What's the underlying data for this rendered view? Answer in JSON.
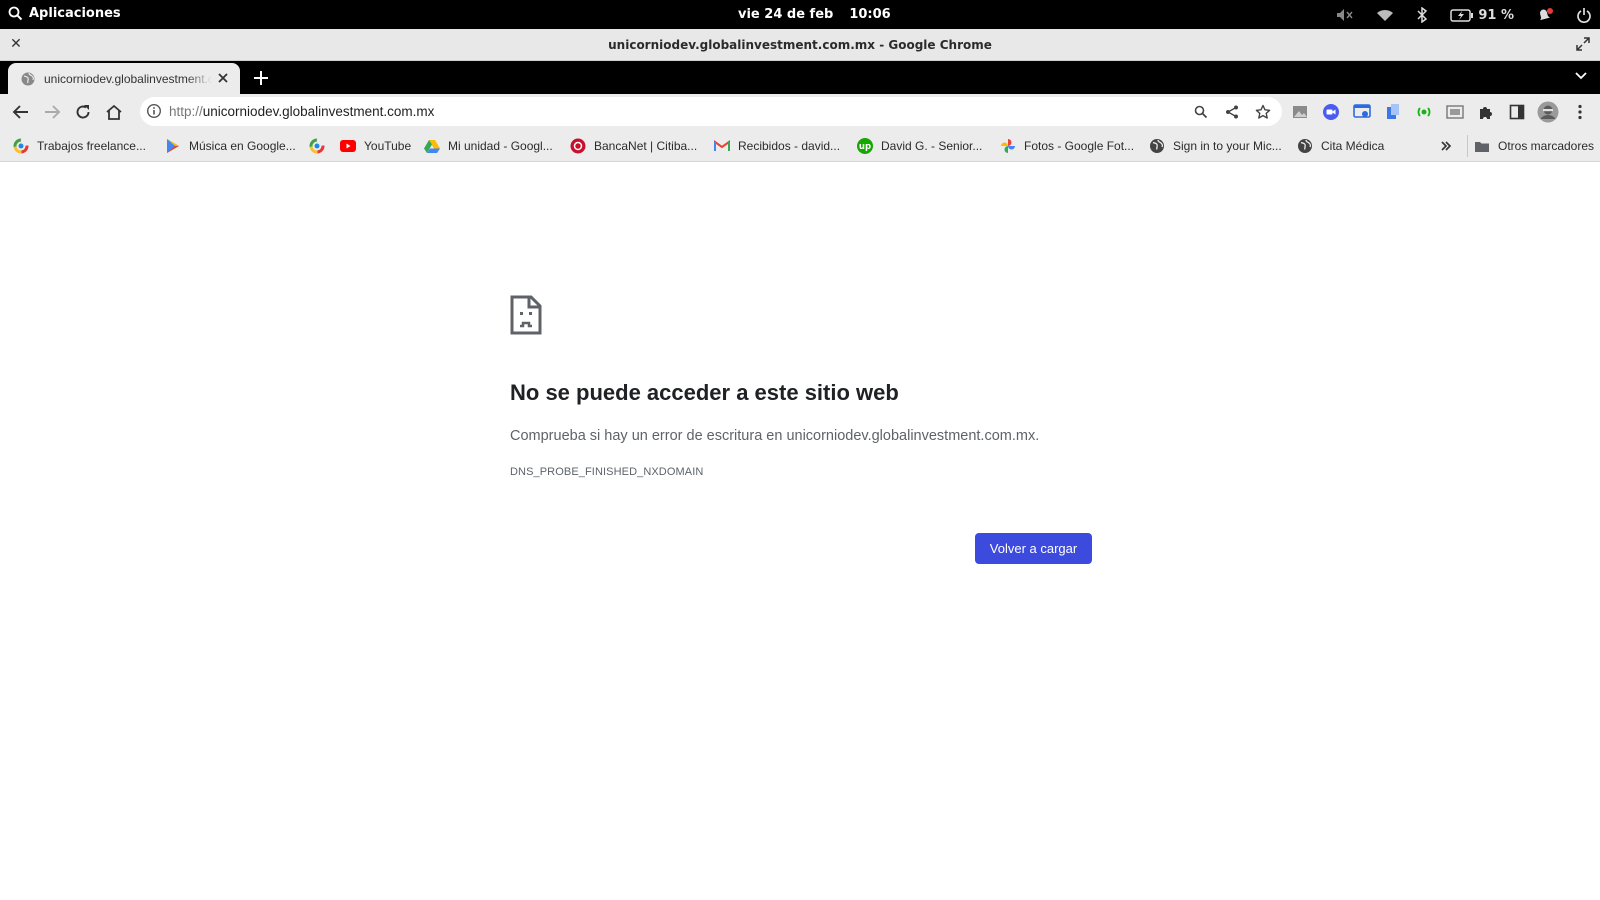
{
  "system_bar": {
    "apps_label": "Aplicaciones",
    "date": "vie 24 de feb",
    "time": "10:06",
    "battery": "91 %"
  },
  "window": {
    "title": "unicorniodev.globalinvestment.com.mx - Google Chrome"
  },
  "tabs": [
    {
      "title": "unicorniodev.globalinvestment.com.mx"
    }
  ],
  "omnibox": {
    "scheme": "http://",
    "host": "unicorniodev.globalinvestment.com.mx"
  },
  "bookmarks": [
    {
      "label": "Trabajos freelance...",
      "icon": "rainbow-circle-icon"
    },
    {
      "label": "Música en Google...",
      "icon": "play-store-icon"
    },
    {
      "label": "",
      "icon": "rainbow-circle-icon"
    },
    {
      "label": "YouTube",
      "icon": "youtube-icon"
    },
    {
      "label": "Mi unidad - Googl...",
      "icon": "google-drive-icon"
    },
    {
      "label": "BancaNet | Citiba...",
      "icon": "citibanamex-icon"
    },
    {
      "label": "Recibidos - david...",
      "icon": "gmail-icon"
    },
    {
      "label": "David G. - Senior...",
      "icon": "upwork-icon"
    },
    {
      "label": "Fotos - Google Fot...",
      "icon": "google-photos-icon"
    },
    {
      "label": "Sign in to your Mic...",
      "icon": "globe-icon"
    },
    {
      "label": "Cita Médica",
      "icon": "globe-icon"
    }
  ],
  "other_bookmarks": "Otros marcadores",
  "error_page": {
    "title": "No se puede acceder a este sitio web",
    "description": "Comprueba si hay un error de escritura en unicorniodev.globalinvestment.com.mx.",
    "code": "DNS_PROBE_FINISHED_NXDOMAIN",
    "reload_label": "Volver a cargar"
  },
  "colors": {
    "accent": "#3c4bde",
    "topbar": "#000000",
    "toolbar": "#ececec"
  }
}
